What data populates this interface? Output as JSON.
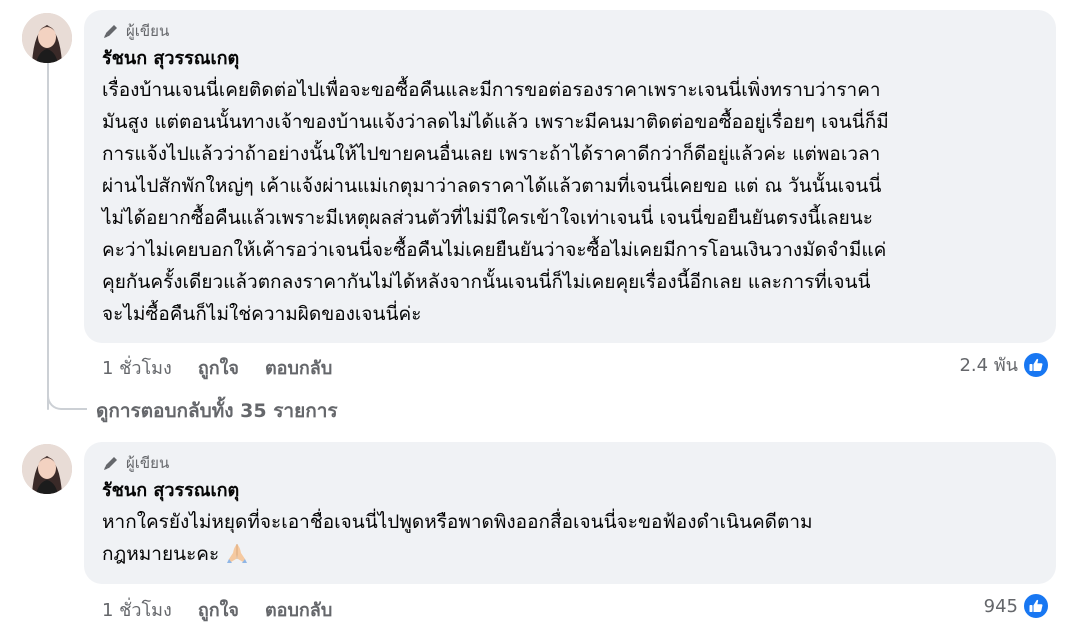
{
  "comments": [
    {
      "badge": "ผู้เขียน",
      "author": "รัชนก สุวรรณเกตุ",
      "text": "เรื่องบ้านเจนนี่เคยติดต่อไปเพื่อจะขอซื้อคืนและมีการขอต่อรองราคาเพราะเจนนี่เพิ่งทราบว่าราคา\nมันสูง แต่ตอนนั้นทางเจ้าของบ้านแจ้งว่าลดไม่ได้แล้ว เพราะมีคนมาติดต่อขอซื้ออยู่เรื่อยๆ เจนนี่ก็มี\nการแจ้งไปแล้วว่าถ้าอย่างนั้นให้ไปขายคนอื่นเลย เพราะถ้าได้ราคาดีกว่าก็ดีอยู่แล้วค่ะ แต่พอเวลา\nผ่านไปสักพักใหญ่ๆ เค้าแจ้งผ่านแม่เกตุมาว่าลดราคาได้แล้วตามที่เจนนี่เคยขอ แต่ ณ วันนั้นเจนนี่\nไม่ได้อยากซื้อคืนแล้วเพราะมีเหตุผลส่วนตัวที่ไม่มีใครเข้าใจเท่าเจนนี่ เจนนี่ขอยืนยันตรงนี้เลยนะ\nคะว่าไม่เคยบอกให้เค้ารอว่าเจนนี่จะซื้อคืนไม่เคยยืนยันว่าจะซื้อไม่เคยมีการโอนเงินวางมัดจำมีแค่\nคุยกันครั้งเดียวแล้วตกลงราคากันไม่ได้หลังจากนั้นเจนนี่ก็ไม่เคยคุยเรื่องนี้อีกเลย และการที่เจนนี่\nจะไม่ซื้อคืนก็ไม่ใช่ความผิดของเจนนี่ค่ะ",
      "time": "1 ชั่วโมง",
      "like_label": "ถูกใจ",
      "reply_label": "ตอบกลับ",
      "reaction_count": "2.4 พัน",
      "reaction_icon": "like-icon"
    },
    {
      "badge": "ผู้เขียน",
      "author": "รัชนก สุวรรณเกตุ",
      "text": "หากใครยังไม่หยุดที่จะเอาชื่อเจนนี่ไปพูดหรือพาดพิงออกสื่อเจนนี่จะขอฟ้องดำเนินคดีตาม\nกฎหมายนะคะ",
      "emoji": "folded-hands-emoji",
      "time": "1 ชั่วโมง",
      "like_label": "ถูกใจ",
      "reply_label": "ตอบกลับ",
      "reaction_count": "945",
      "reaction_icon": "like-icon"
    }
  ],
  "view_replies": "ดูการตอบกลับทั้ง 35 รายการ",
  "colors": {
    "bubble_bg": "#f0f2f5",
    "secondary_text": "#65676b",
    "like_blue": "#1877f2",
    "thread_line": "#ccd0d5"
  }
}
